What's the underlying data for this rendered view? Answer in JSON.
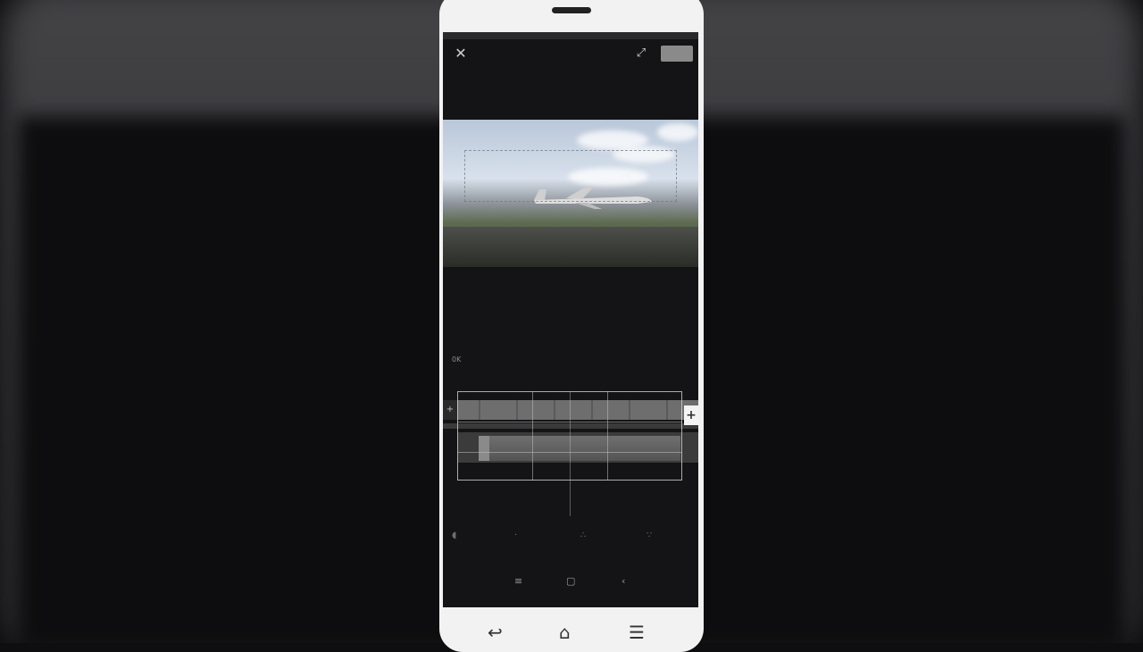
{
  "editor": {
    "close_icon": "close-icon",
    "export_icon": "expand-icon",
    "save_label": "",
    "time_start": "0K",
    "time_mid": "",
    "time_end": ""
  },
  "timeline": {
    "add_left_label": "+",
    "add_right_label": "+"
  },
  "tools": [
    {
      "name": "tool-volume",
      "icon": "volume-icon"
    },
    {
      "name": "tool-split",
      "icon": "split-icon"
    },
    {
      "name": "tool-speed",
      "icon": "speed-icon"
    },
    {
      "name": "tool-delete",
      "icon": "delete-icon"
    }
  ],
  "android_nav": {
    "recents": "recents-icon",
    "home": "home-icon",
    "back": "back-icon"
  },
  "phone_nav": {
    "back": "back-arrow-icon",
    "home": "home-outline-icon",
    "menu": "menu-icon"
  }
}
